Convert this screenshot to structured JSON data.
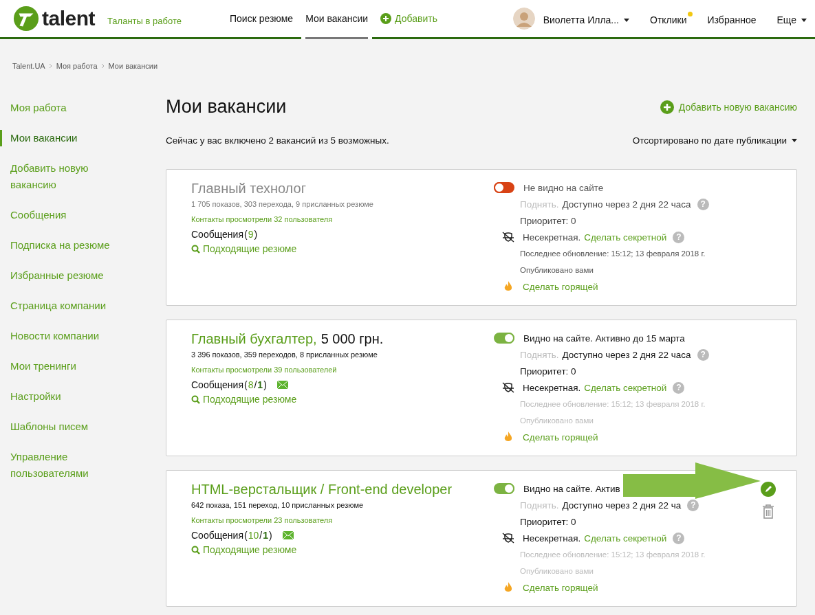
{
  "header": {
    "logo": "talent",
    "tagline": "Таланты в работе",
    "nav": [
      {
        "label": "Поиск резюме",
        "kind": "link",
        "selected": false
      },
      {
        "label": "Мои вакансии",
        "kind": "link",
        "selected": true
      },
      {
        "label": "Добавить",
        "kind": "add",
        "selected": false
      }
    ],
    "user": {
      "name": "Виолетта Илла..."
    },
    "links": [
      {
        "label": "Отклики",
        "notification": true,
        "dropdown": false
      },
      {
        "label": "Избранное",
        "notification": false,
        "dropdown": false
      },
      {
        "label": "Еще",
        "notification": false,
        "dropdown": true
      }
    ]
  },
  "breadcrumbs": [
    "Talent.UA",
    "Моя работа",
    "Мои вакансии"
  ],
  "sidebar": {
    "items": [
      {
        "label": "Моя работа",
        "selected": false
      },
      {
        "label": "Мои вакансии",
        "selected": true
      },
      {
        "label": "Добавить новую вакансию",
        "selected": false
      },
      {
        "label": "Сообщения",
        "selected": false
      },
      {
        "label": "Подписка на резюме",
        "selected": false
      },
      {
        "label": "Избранные резюме",
        "selected": false
      },
      {
        "label": "Страница компании",
        "selected": false
      },
      {
        "label": "Новости компании",
        "selected": false
      },
      {
        "label": "Мои тренинги",
        "selected": false
      },
      {
        "label": "Настройки",
        "selected": false
      },
      {
        "label": "Шаблоны писем",
        "selected": false
      },
      {
        "label": "Управление пользователями",
        "selected": false
      }
    ]
  },
  "page": {
    "title": "Мои вакансии",
    "add_button": "Добавить новую вакансию",
    "summary": "Сейчас у вас включено 2 вакансий из 5 возможных.",
    "sort": "Отсортировано по дате публикации"
  },
  "vacancies": [
    {
      "title": "Главный технолог",
      "visible": false,
      "stats": "1 705 показов, 303 перехода, 9 присланных резюме",
      "contacts": "Контакты просмотрели 32 пользователя",
      "messages_label": "Сообщения",
      "messages_open": "(",
      "messages_total": "9",
      "messages_close": ")",
      "raise_help": "?",
      "secret_help": "?",
      "matching": "Подходящие резюме",
      "status": "Не видно на сайте",
      "raise": "Поднять.",
      "availability": "Доступно через 2 дня 22 часа",
      "priority": "Приоритет: 0",
      "secrecy": "Несекретная.",
      "secret_link": "Сделать секретной",
      "updated": "Последнее обновление: 15:12; 13 февраля 2018 г.",
      "published": "Опубликовано вами",
      "hot_link": "Сделать горящей",
      "actions_shown": false,
      "arrow_overlay": false
    },
    {
      "title": "Главный бухгалтер,",
      "salary": "5 000 грн.",
      "visible": true,
      "stats": "3 396 показов, 359 переходов, 8 присланных резюме",
      "contacts": "Контакты просмотрели 39 пользователей",
      "messages_label": "Сообщения",
      "messages_open": "(",
      "messages_total": "8",
      "messages_sep": "/",
      "messages_new": "1",
      "messages_close": ")",
      "raise_help": "?",
      "secret_help": "?",
      "matching": "Подходящие резюме",
      "status": "Видно на сайте. Активно до 15 марта",
      "raise": "Поднять.",
      "availability": "Доступно через 2 дня 22 часа",
      "priority": "Приоритет: 0",
      "secrecy": "Несекретная.",
      "secret_link": "Сделать секретной",
      "updated": "Последнее обновление: 15:12; 13 февраля 2018 г.",
      "published": "Опубликовано вами",
      "hot_link": "Сделать горящей",
      "actions_shown": false,
      "arrow_overlay": false
    },
    {
      "title": "HTML-верстальщик / Front-end developer",
      "visible": true,
      "stats": "642 показа, 151 переход, 10 присланных резюме",
      "contacts": "Контакты просмотрели 23 пользователя",
      "messages_label": "Сообщения",
      "messages_open": "(",
      "messages_total": "10",
      "messages_sep": "/",
      "messages_new": "1",
      "messages_close": ")",
      "raise_help": "?",
      "secret_help": "?",
      "matching": "Подходящие резюме",
      "status": "Видно на сайте. Актив",
      "raise": "Поднять.",
      "availability": "Доступно через 2 дня 22 ча",
      "priority": "Приоритет: 0",
      "secrecy": "Несекретная.",
      "secret_link": "Сделать секретной",
      "updated": "Последнее обновление: 15:12; 13 февраля 2018 г.",
      "published": "Опубликовано вами",
      "hot_link": "Сделать горящей",
      "actions_shown": true,
      "arrow_overlay": true
    }
  ]
}
